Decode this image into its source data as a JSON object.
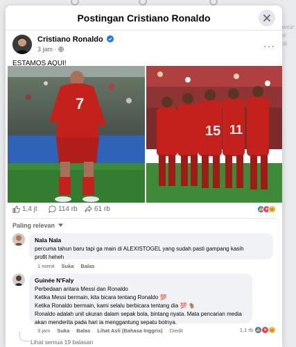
{
  "colors": {
    "brand_blue": "#1877f2",
    "like_blue": "#1877f2",
    "love_red": "#f33e58",
    "haha_yellow": "#f7b125",
    "text_secondary": "#65676b"
  },
  "backdrop": {
    "peek_lines": [
      "'emin",
      "er",
      "oli"
    ]
  },
  "modal": {
    "title": "Postingan Cristiano Ronaldo",
    "close_icon": "close-icon"
  },
  "post": {
    "author": "Cristiano Ronaldo",
    "time": "3 jam",
    "audience_icon": "globe-icon",
    "caption": "ESTAMOS AQUI!",
    "stats": {
      "reactions": "1,4 jt",
      "comments": "114 rb",
      "shares": "61 rb"
    }
  },
  "comments_section": {
    "sort_label": "Paling relevan",
    "comments": [
      {
        "name": "Nala Nala",
        "lines": [
          "percuma tahun baru tapi ga main di ALEXISTOGEL yang sudah pasti gampang kasih",
          "profit heheh"
        ],
        "time": "1 menit",
        "like": "Suka",
        "reply": "Balas"
      },
      {
        "name": "Guinée N'Faly",
        "lines": [
          "Perbedaan antara Messi dan Ronaldo",
          "Ketika Messi bermain, kita bicara tentang Ronaldo 💯",
          "Ketika Ronaldo bermain, kami selalu berbicara tentang dia 💯 🐐",
          "Ronaldo adalah unit ukuran dalam sepak bola, bintang nyata. Mata pencarian media",
          "akan menderita pada hari ia menggantung sepatu botnya."
        ],
        "time": "3 jam",
        "like": "Suka",
        "reply": "Balas",
        "see_original": "Lihat Asli (Bahasa Inggris)",
        "edited": "Diedit",
        "reactions": "1,1 rb"
      }
    ],
    "view_replies": "Lihat semua 19 balasan"
  }
}
